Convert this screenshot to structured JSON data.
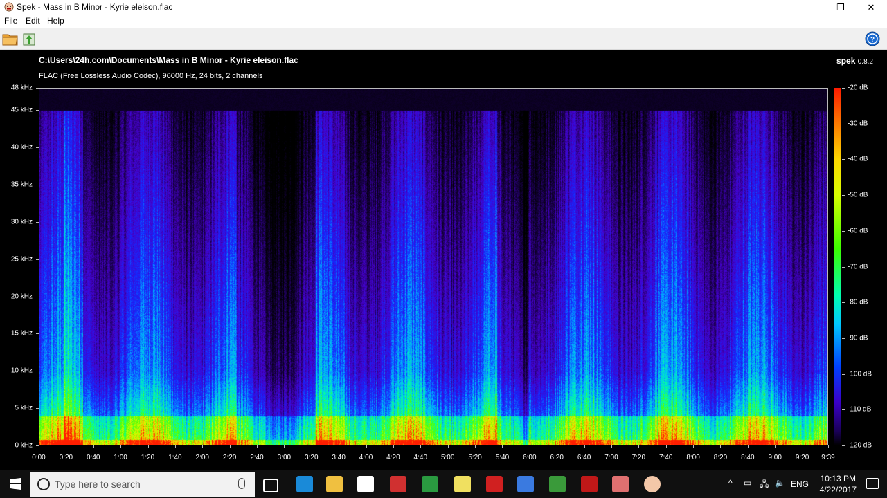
{
  "window": {
    "title": "Spek - Mass in B Minor - Kyrie eleison.flac",
    "minimize_glyph": "—",
    "maximize_glyph": "❐",
    "close_glyph": "✕"
  },
  "menu": {
    "items": [
      "File",
      "Edit",
      "Help"
    ]
  },
  "toolbar": {
    "open_icon": "open-folder-icon",
    "save_icon": "save-export-icon",
    "help_icon": "help-question-icon"
  },
  "viewer": {
    "file_path": "C:\\Users\\24h.com\\Documents\\Mass in B Minor - Kyrie eleison.flac",
    "file_info": "FLAC (Free Lossless Audio Codec), 96000 Hz, 24 bits, 2 channels",
    "brand": "spek",
    "version": "0.8.2",
    "y_axis_ticks": [
      "48 kHz",
      "45 kHz",
      "40 kHz",
      "35 kHz",
      "30 kHz",
      "25 kHz",
      "20 kHz",
      "15 kHz",
      "10 kHz",
      "5 kHz",
      "0 kHz"
    ],
    "y_axis_values_khz": [
      48,
      45,
      40,
      35,
      30,
      25,
      20,
      15,
      10,
      5,
      0
    ],
    "x_axis_ticks": [
      "0:00",
      "0:20",
      "0:40",
      "1:00",
      "1:20",
      "1:40",
      "2:00",
      "2:20",
      "2:40",
      "3:00",
      "3:20",
      "3:40",
      "4:00",
      "4:20",
      "4:40",
      "5:00",
      "5:20",
      "5:40",
      "6:00",
      "6:20",
      "6:40",
      "7:00",
      "7:20",
      "7:40",
      "8:00",
      "8:20",
      "8:40",
      "9:00",
      "9:20",
      "9:39"
    ],
    "x_axis_values_sec": [
      0,
      20,
      40,
      60,
      80,
      100,
      120,
      140,
      160,
      180,
      200,
      220,
      240,
      260,
      280,
      300,
      320,
      340,
      360,
      380,
      400,
      420,
      440,
      460,
      480,
      500,
      520,
      540,
      560,
      579
    ],
    "db_ticks": [
      "-20 dB",
      "-30 dB",
      "-40 dB",
      "-50 dB",
      "-60 dB",
      "-70 dB",
      "-80 dB",
      "-90 dB",
      "-100 dB",
      "-110 dB",
      "-120 dB"
    ],
    "db_values": [
      -20,
      -30,
      -40,
      -50,
      -60,
      -70,
      -80,
      -90,
      -100,
      -110,
      -120
    ],
    "duration_sec": 579,
    "max_khz": 48
  },
  "taskbar": {
    "search_placeholder": "Type here to search",
    "lang": "ENG",
    "time": "10:13 PM",
    "date": "4/22/2017",
    "pinned": [
      "task-view-icon",
      "edge-icon",
      "file-explorer-icon",
      "store-icon",
      "app-red-icon",
      "chrome-icon",
      "sticky-notes-icon",
      "red-star-icon",
      "browser-icon",
      "evernote-icon",
      "app-m-icon",
      "app-image-icon",
      "spek-icon"
    ]
  },
  "colors": {
    "accent": "#0a64c8",
    "background": "#000000"
  }
}
